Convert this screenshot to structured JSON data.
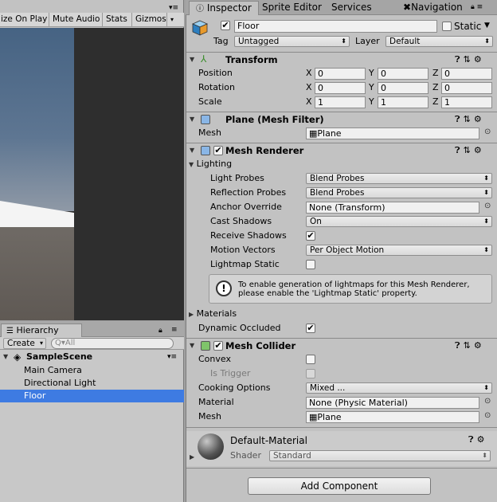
{
  "game_toolbar": {
    "items": [
      "ize On Play",
      "Mute Audio",
      "Stats",
      "Gizmos"
    ]
  },
  "hierarchy": {
    "tab": "Hierarchy",
    "create": "Create",
    "search_placeholder": "All",
    "scene": "SampleScene",
    "items": [
      "Main Camera",
      "Directional Light",
      "Floor"
    ],
    "selected": "Floor"
  },
  "inspector_tabs": {
    "inspector": "Inspector",
    "sprite_editor": "Sprite Editor",
    "services": "Services",
    "navigation": "Navigation"
  },
  "object": {
    "name": "Floor",
    "static_label": "Static",
    "tag_label": "Tag",
    "tag": "Untagged",
    "layer_label": "Layer",
    "layer": "Default"
  },
  "transform": {
    "title": "Transform",
    "position_label": "Position",
    "rotation_label": "Rotation",
    "scale_label": "Scale",
    "position": [
      "0",
      "0",
      "0"
    ],
    "rotation": [
      "0",
      "0",
      "0"
    ],
    "scale": [
      "1",
      "1",
      "1"
    ],
    "axes": [
      "X",
      "Y",
      "Z"
    ]
  },
  "mesh_filter": {
    "title": "Plane (Mesh Filter)",
    "mesh_label": "Mesh",
    "mesh": "Plane"
  },
  "mesh_renderer": {
    "title": "Mesh Renderer",
    "lighting": "Lighting",
    "light_probes_label": "Light Probes",
    "light_probes": "Blend Probes",
    "reflection_probes_label": "Reflection Probes",
    "reflection_probes": "Blend Probes",
    "anchor_override_label": "Anchor Override",
    "anchor_override": "None (Transform)",
    "cast_shadows_label": "Cast Shadows",
    "cast_shadows": "On",
    "receive_shadows_label": "Receive Shadows",
    "motion_vectors_label": "Motion Vectors",
    "motion_vectors": "Per Object Motion",
    "lightmap_static_label": "Lightmap Static",
    "info_line1": "To enable generation of lightmaps for this Mesh Renderer,",
    "info_line2": "please enable the 'Lightmap Static' property.",
    "materials": "Materials",
    "dynamic_occluded_label": "Dynamic Occluded"
  },
  "mesh_collider": {
    "title": "Mesh Collider",
    "convex_label": "Convex",
    "is_trigger_label": "Is Trigger",
    "cooking_options_label": "Cooking Options",
    "cooking_options": "Mixed ...",
    "material_label": "Material",
    "material": "None (Physic Material)",
    "mesh_label": "Mesh",
    "mesh": "Plane"
  },
  "material": {
    "name": "Default-Material",
    "shader_label": "Shader",
    "shader": "Standard"
  },
  "add_component": "Add Component",
  "colors": {
    "selection": "#3e7be2",
    "panel": "#c2c2c2"
  }
}
